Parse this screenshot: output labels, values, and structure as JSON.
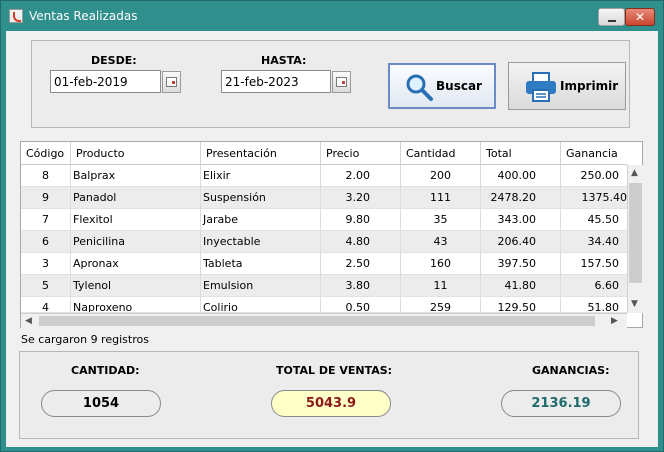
{
  "window": {
    "title": "Ventas Realizadas",
    "close_glyph": "✕"
  },
  "filters": {
    "desde_label": "DESDE:",
    "desde_value": "01-feb-2019",
    "hasta_label": "HASTA:",
    "hasta_value": "21-feb-2023"
  },
  "toolbar": {
    "buscar_label": "Buscar",
    "imprimir_label": "Imprimir"
  },
  "table": {
    "columns": [
      "Código",
      "Producto",
      "Presentación",
      "Precio",
      "Cantidad",
      "Total",
      "Ganancia"
    ],
    "rows": [
      [
        "8",
        "Balprax",
        "Elixir",
        "2.00",
        "200",
        "400.00",
        "250.00"
      ],
      [
        "9",
        "Panadol",
        "Suspensión",
        "3.20",
        "111",
        "2478.20",
        "1375.40"
      ],
      [
        "7",
        "Flexitol",
        "Jarabe",
        "9.80",
        "35",
        "343.00",
        "45.50"
      ],
      [
        "6",
        "Penicilina",
        "Inyectable",
        "4.80",
        "43",
        "206.40",
        "34.40"
      ],
      [
        "3",
        "Apronax",
        "Tableta",
        "2.50",
        "160",
        "397.50",
        "157.50"
      ],
      [
        "5",
        "Tylenol",
        "Emulsion",
        "3.80",
        "11",
        "41.80",
        "6.60"
      ],
      [
        "4",
        "Naproxeno",
        "Colirio",
        "0.50",
        "259",
        "129.50",
        "51.80"
      ]
    ]
  },
  "status_text": "Se cargaron 9 registros",
  "summary": {
    "cantidad_label": "CANTIDAD:",
    "cantidad_value": "1054",
    "total_label": "TOTAL DE VENTAS:",
    "total_value": "5043.9",
    "ganancias_label": "GANANCIAS:",
    "ganancias_value": "2136.19"
  },
  "colors": {
    "titlebar": "#2e8f8c",
    "total_bg": "#ffffc8",
    "total_text": "#8b1a1a",
    "ganancias_text": "#1f6b6b"
  },
  "icons": {
    "app": "java-cup-icon",
    "calendar": "calendar-icon",
    "search": "magnifier-icon",
    "print": "printer-icon"
  }
}
